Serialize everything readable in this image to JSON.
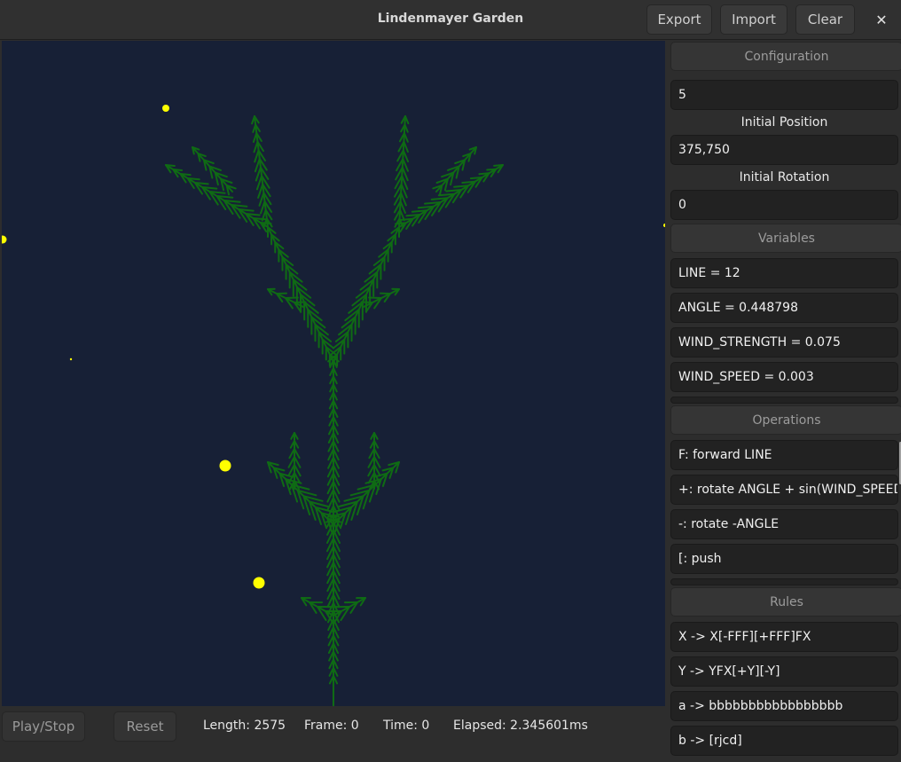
{
  "header": {
    "title": "Lindenmayer Garden",
    "export_label": "Export",
    "import_label": "Import",
    "clear_label": "Clear",
    "close_glyph": "✕"
  },
  "configuration": {
    "header": "Configuration",
    "iterations": "5",
    "initial_position_label": "Initial Position",
    "initial_position": "375,750",
    "initial_rotation_label": "Initial Rotation",
    "initial_rotation": "0"
  },
  "variables": {
    "header": "Variables",
    "items": [
      "LINE = 12",
      "ANGLE = 0.448798",
      "WIND_STRENGTH = 0.075",
      "WIND_SPEED = 0.003"
    ]
  },
  "operations": {
    "header": "Operations",
    "items": [
      "F: forward LINE",
      "+: rotate ANGLE + sin(WIND_SPEED*",
      "-: rotate -ANGLE",
      "[: push"
    ]
  },
  "rules": {
    "header": "Rules",
    "items": [
      "X -> X[-FFF][+FFF]FX",
      "Y  -> YFX[+Y][-Y]",
      "a -> bbbbbbbbbbbbbbbbb",
      "b ->  [rjcd]"
    ]
  },
  "controls": {
    "play_stop_label": "Play/Stop",
    "reset_label": "Reset"
  },
  "stats": {
    "length": "Length: 2575",
    "frame": "Frame: 0",
    "time": "Time: 0",
    "elapsed": "Elapsed: 2.345601ms"
  },
  "colors": {
    "canvas_background": "#172036",
    "plant": "#0f6b14",
    "particles": "#ffff00"
  }
}
